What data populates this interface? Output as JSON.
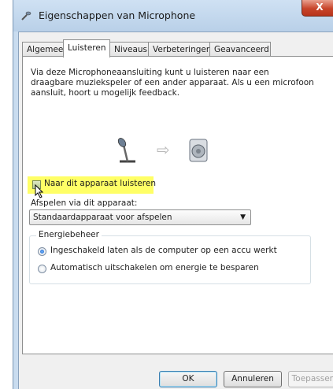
{
  "window": {
    "title": "Eigenschappen van Microphone",
    "close_label": "X"
  },
  "tabs": [
    {
      "label": "Algemeen",
      "active": false
    },
    {
      "label": "Luisteren",
      "active": true
    },
    {
      "label": "Niveaus",
      "active": false
    },
    {
      "label": "Verbeteringen",
      "active": false
    },
    {
      "label": "Geavanceerd",
      "active": false
    }
  ],
  "listen": {
    "description": "Via deze Microphoneaansluiting kunt u luisteren naar een draagbare muziekspeler of een ander apparaat. Als u een microfoon aansluit, hoort u mogelijk feedback.",
    "arrow_glyph": "⇨",
    "checkbox_label": "Naar dit apparaat luisteren",
    "checkbox_checked": false,
    "highlight_color": "#ffff66",
    "playback_label": "Afspelen via dit apparaat:",
    "playback_value": "Standaardapparaat voor afspelen",
    "dropdown_arrow": "▼"
  },
  "power": {
    "title": "Energiebeheer",
    "options": [
      {
        "label": "Ingeschakeld laten als de computer op een accu werkt",
        "selected": true
      },
      {
        "label": "Automatisch uitschakelen om energie te besparen",
        "selected": false
      }
    ]
  },
  "buttons": {
    "ok": "OK",
    "cancel": "Annuleren",
    "apply": "Toepassen"
  },
  "icons": {
    "microphone": "microphone-icon",
    "speaker": "speaker-icon",
    "cursor": "mouse-pointer-icon"
  }
}
